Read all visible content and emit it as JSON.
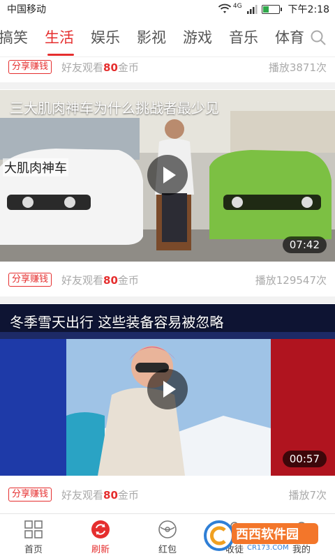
{
  "status_bar": {
    "carrier": "中国移动",
    "network": "4G",
    "time": "下午2:18"
  },
  "tabs": {
    "items": [
      "搞笑",
      "生活",
      "娱乐",
      "影视",
      "游戏",
      "音乐",
      "体育"
    ],
    "active_index": 1
  },
  "feed": [
    {
      "share_label": "分享赚钱",
      "friend_prefix": "好友观看",
      "gold_amount": "80",
      "gold_unit": "金币",
      "plays": "播放3871次"
    },
    {
      "title": "三大肌肉神车为什么挑战者最少见",
      "overlay_text": "大肌肉神车",
      "duration": "07:42",
      "share_label": "分享赚钱",
      "friend_prefix": "好友观看",
      "gold_amount": "80",
      "gold_unit": "金币",
      "plays": "播放129547次"
    },
    {
      "title": "冬季雪天出行 这些装备容易被忽略",
      "duration": "00:57",
      "share_label": "分享赚钱",
      "friend_prefix": "好友观看",
      "gold_amount": "80",
      "gold_unit": "金币",
      "plays": "播放7次"
    }
  ],
  "bottom_nav": [
    {
      "label": "首页",
      "icon": "home-grid-icon"
    },
    {
      "label": "刷新",
      "icon": "refresh-icon"
    },
    {
      "label": "红包",
      "icon": "red-packet-icon"
    },
    {
      "label": "收徒",
      "icon": "apprentice-icon"
    },
    {
      "label": "我的",
      "icon": "profile-icon"
    }
  ],
  "watermark": {
    "text": "西西软件园",
    "domain": "CR173.COM"
  },
  "colors": {
    "accent": "#e52e2e",
    "muted_text": "#aaaaaa",
    "divider": "#f2f2f2"
  }
}
